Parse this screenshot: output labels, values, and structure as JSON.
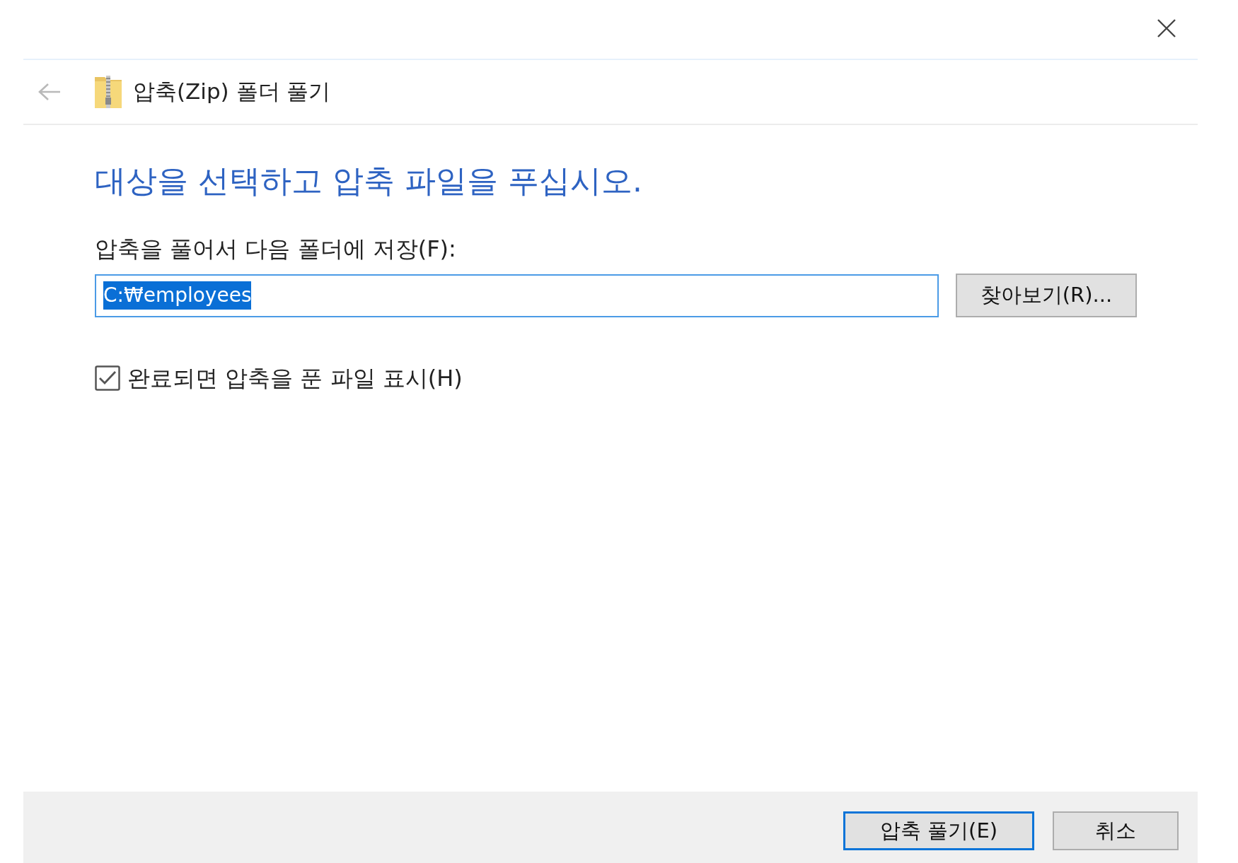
{
  "header": {
    "back_disabled": true,
    "title": "압축(Zip) 폴더 풀기"
  },
  "heading": "대상을 선택하고 압축 파일을 푸십시오.",
  "destination": {
    "label": "압축을 풀어서 다음 폴더에 저장(F):",
    "value": "C:₩employees",
    "focused": true,
    "text_selected": true,
    "browse_button": "찾아보기(R)..."
  },
  "options": [
    {
      "label": "완료되면 압축을 푼 파일 표시(H)",
      "checked": true
    }
  ],
  "buttons": [
    {
      "label": "압축 풀기(E)",
      "default": true
    },
    {
      "label": "취소",
      "default": false
    }
  ]
}
